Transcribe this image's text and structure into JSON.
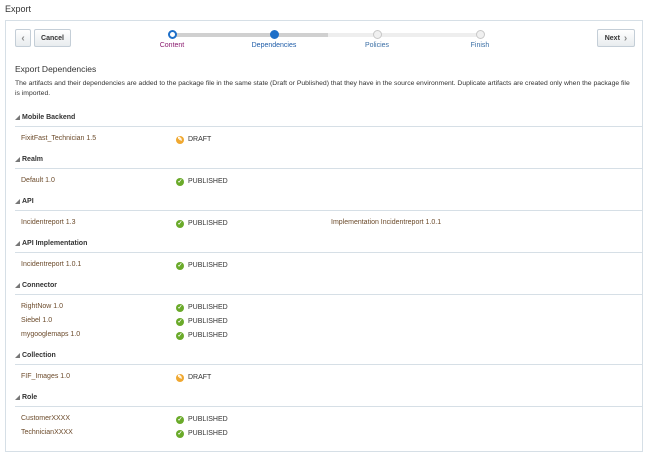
{
  "title": "Export",
  "toolbar": {
    "cancel": "Cancel",
    "next": "Next"
  },
  "train": {
    "steps": [
      {
        "label": "Content",
        "color": "#8a1a6e"
      },
      {
        "label": "Dependencies",
        "color": "#1e5ca8"
      },
      {
        "label": "Policies",
        "color": "#3a6ea5"
      },
      {
        "label": "Finish",
        "color": "#3a6ea5"
      }
    ],
    "current": 1
  },
  "heading": "Export Dependencies",
  "description": "The artifacts and their dependencies are added to the package file in the same state (Draft or Published) that they have in the source environment. Duplicate artifacts are created only when the package file is imported.",
  "status_colors": {
    "DRAFT": "#f0a830",
    "PUBLISHED": "#6aaa2a"
  },
  "sections": [
    {
      "title": "Mobile Backend",
      "items": [
        {
          "name": "FixitFast_Technician  1.5",
          "status": "DRAFT"
        }
      ]
    },
    {
      "title": "Realm",
      "items": [
        {
          "name": "Default  1.0",
          "status": "PUBLISHED"
        }
      ]
    },
    {
      "title": "API",
      "items": [
        {
          "name": "Incidentreport  1.3",
          "status": "PUBLISHED",
          "extra": "Implementation Incidentreport 1.0.1"
        }
      ]
    },
    {
      "title": "API Implementation",
      "items": [
        {
          "name": "Incidentreport  1.0.1",
          "status": "PUBLISHED"
        }
      ]
    },
    {
      "title": "Connector",
      "items": [
        {
          "name": "RightNow  1.0",
          "status": "PUBLISHED"
        },
        {
          "name": "Siebel  1.0",
          "status": "PUBLISHED"
        },
        {
          "name": "mygooglemaps  1.0",
          "status": "PUBLISHED"
        }
      ]
    },
    {
      "title": "Collection",
      "items": [
        {
          "name": "FIF_Images  1.0",
          "status": "DRAFT"
        }
      ]
    },
    {
      "title": "Role",
      "items": [
        {
          "name": "CustomerXXXX",
          "status": "PUBLISHED"
        },
        {
          "name": "TechnicianXXXX",
          "status": "PUBLISHED"
        }
      ]
    }
  ]
}
